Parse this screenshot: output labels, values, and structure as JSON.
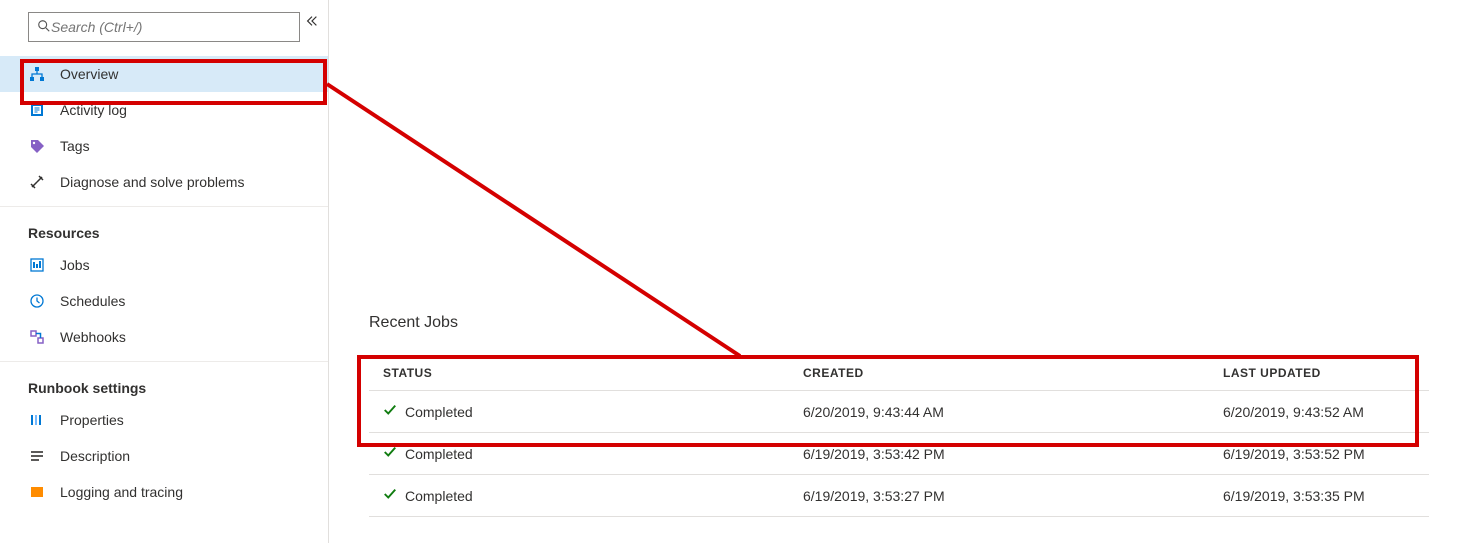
{
  "search": {
    "placeholder": "Search (Ctrl+/)"
  },
  "sidebar": {
    "items": [
      {
        "label": "Overview"
      },
      {
        "label": "Activity log"
      },
      {
        "label": "Tags"
      },
      {
        "label": "Diagnose and solve problems"
      }
    ],
    "section_resources": "Resources",
    "resources": [
      {
        "label": "Jobs"
      },
      {
        "label": "Schedules"
      },
      {
        "label": "Webhooks"
      }
    ],
    "section_runbook": "Runbook settings",
    "runbook": [
      {
        "label": "Properties"
      },
      {
        "label": "Description"
      },
      {
        "label": "Logging and tracing"
      }
    ]
  },
  "main": {
    "recent_title": "Recent Jobs",
    "columns": {
      "status": "STATUS",
      "created": "CREATED",
      "updated": "LAST UPDATED"
    },
    "rows": [
      {
        "status": "Completed",
        "created": "6/20/2019, 9:43:44 AM",
        "updated": "6/20/2019, 9:43:52 AM"
      },
      {
        "status": "Completed",
        "created": "6/19/2019, 3:53:42 PM",
        "updated": "6/19/2019, 3:53:52 PM"
      },
      {
        "status": "Completed",
        "created": "6/19/2019, 3:53:27 PM",
        "updated": "6/19/2019, 3:53:35 PM"
      }
    ]
  }
}
